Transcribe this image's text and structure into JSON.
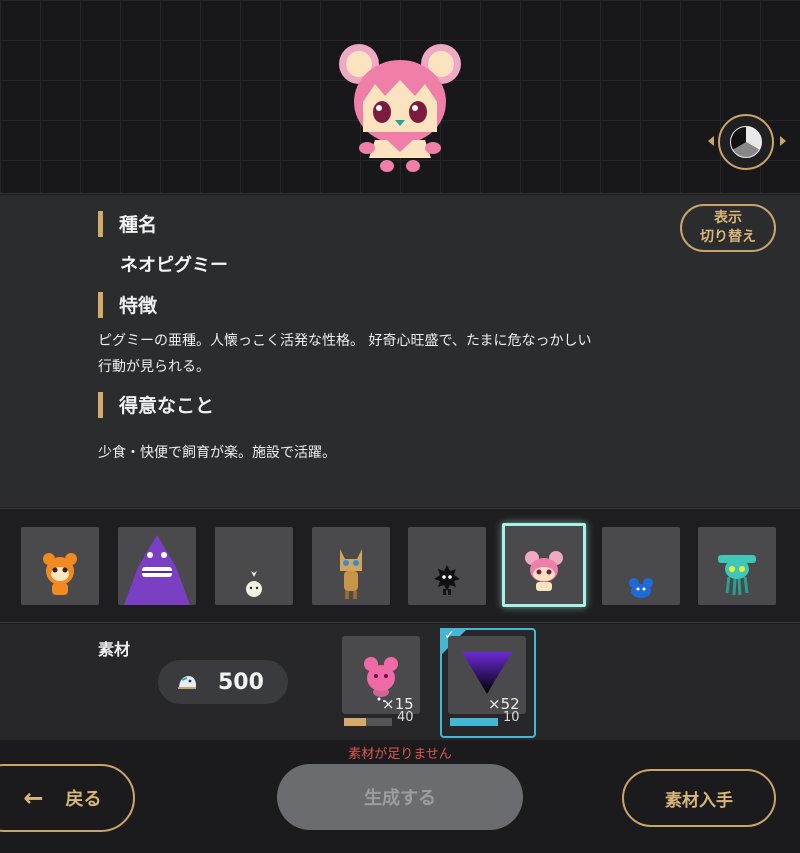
{
  "info": {
    "species_heading": "種名",
    "species_name": "ネオピグミー",
    "traits_heading": "特徴",
    "traits_line1": "ピグミーの亜種。人懐っこく活発な性格。 好奇心旺盛で、たまに危なっかしい",
    "traits_line2": "行動が見られる。",
    "skills_heading": "得意なこと",
    "skills_text": "少食・快便で飼育が楽。施設で活躍。",
    "switch_line1": "表示",
    "switch_line2": "切り替え"
  },
  "strip": {
    "thumbs": [
      {
        "icon": "orange-bear-creature-icon"
      },
      {
        "icon": "purple-monster-icon"
      },
      {
        "icon": "white-sprout-creature-icon"
      },
      {
        "icon": "tan-cat-creature-icon"
      },
      {
        "icon": "black-spiky-creature-icon"
      },
      {
        "icon": "pink-pygmy-creature-icon",
        "selected": true
      },
      {
        "icon": "blue-small-creature-icon"
      },
      {
        "icon": "teal-alien-creature-icon"
      }
    ]
  },
  "materials": {
    "label": "素材",
    "currency_icon": "bird-currency-icon",
    "currency_value": "500",
    "items": [
      {
        "icon": "pink-bear-material-icon",
        "count": "×15",
        "required": "40",
        "progress": 0.45,
        "color": "#d4aa6a"
      },
      {
        "icon": "purple-triangle-material-icon",
        "count": "×52",
        "required": "10",
        "progress": 1.0,
        "color": "#45b6d6",
        "selected": true
      }
    ],
    "warning": "素材が足りません"
  },
  "buttons": {
    "back": "戻る",
    "create": "生成する",
    "get_materials": "素材入手"
  },
  "colors": {
    "accent": "#c9a56b",
    "select": "#a7f1e6",
    "warning": "#e0564c"
  }
}
